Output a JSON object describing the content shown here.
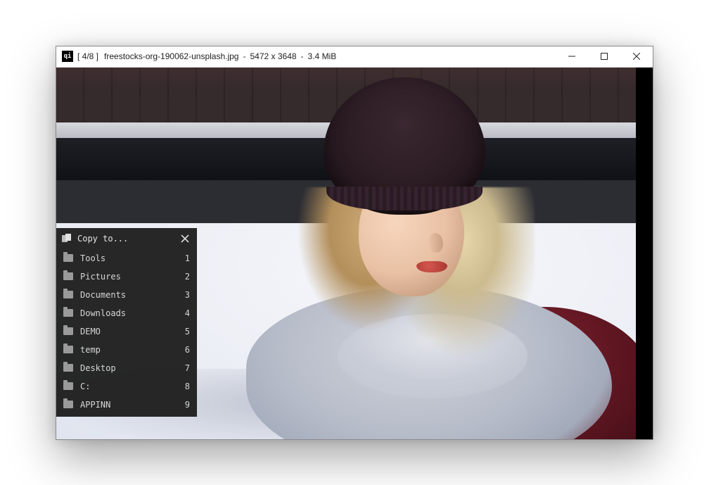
{
  "titlebar": {
    "counter": "[ 4/8 ]",
    "filename": "freestocks-org-190062-unsplash.jpg",
    "dimensions": "5472 x 3648",
    "filesize": "3.4 MiB",
    "separator": "-"
  },
  "alt_text": "Photograph of a young woman in profile wearing a dark knitted beanie, a light grey scarf and a burgundy coat, standing outdoors with snow and a dark railing in the background.",
  "copy_panel": {
    "title": "Copy to...",
    "items": [
      {
        "label": "Tools",
        "key": "1"
      },
      {
        "label": "Pictures",
        "key": "2"
      },
      {
        "label": "Documents",
        "key": "3"
      },
      {
        "label": "Downloads",
        "key": "4"
      },
      {
        "label": "DEMO",
        "key": "5"
      },
      {
        "label": "temp",
        "key": "6"
      },
      {
        "label": "Desktop",
        "key": "7"
      },
      {
        "label": "C:",
        "key": "8"
      },
      {
        "label": "APPINN",
        "key": "9"
      }
    ]
  }
}
